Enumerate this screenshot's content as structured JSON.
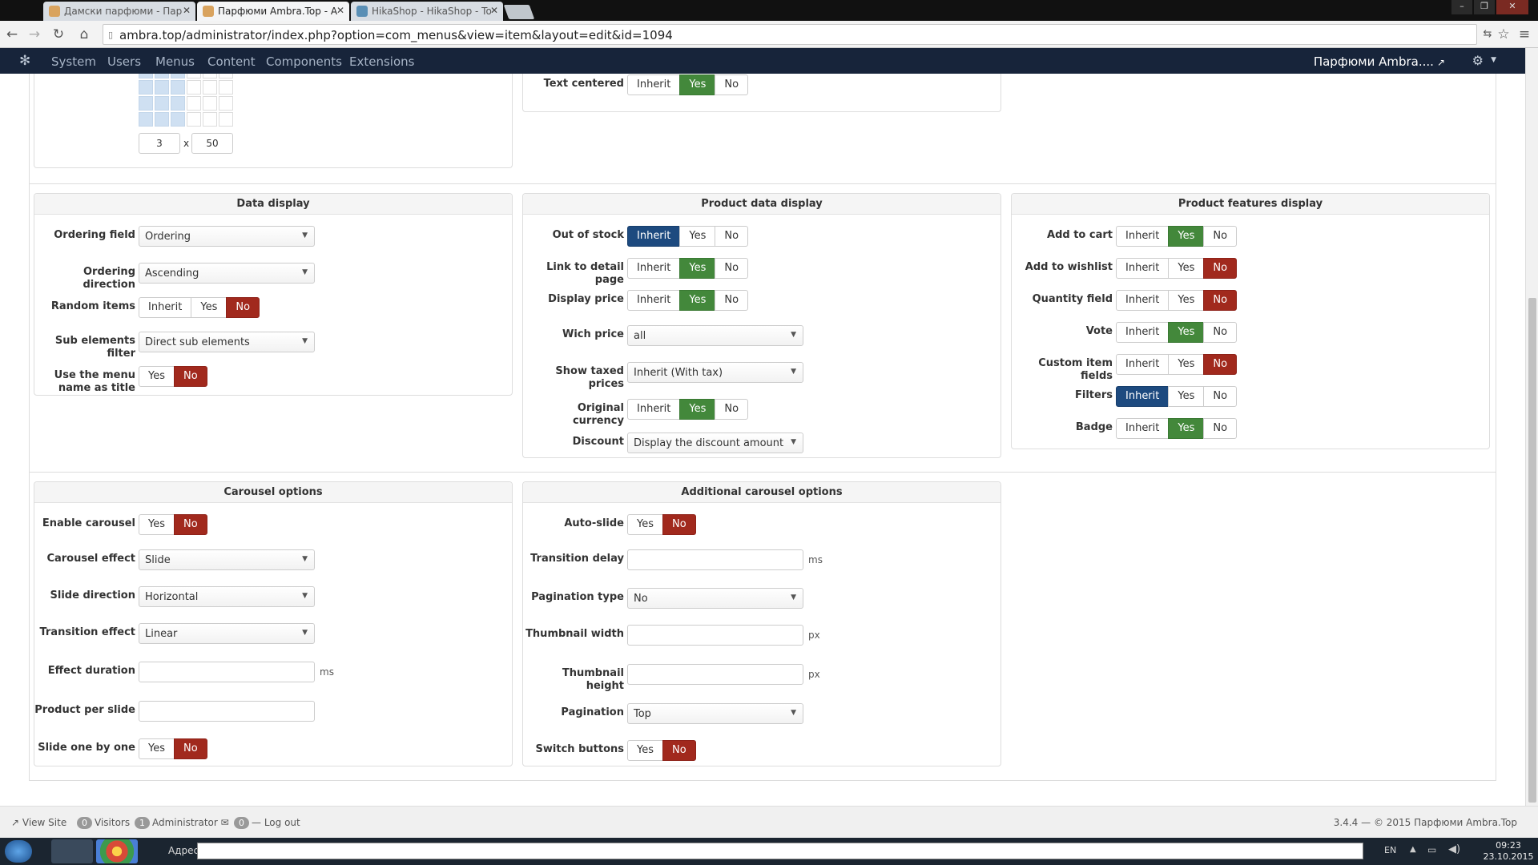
{
  "browser": {
    "tabs": [
      {
        "title": "Дамски парфюми - Пар"
      },
      {
        "title": "Парфюми Ambra.Top - А"
      },
      {
        "title": "HikaShop - HikaShop - To"
      }
    ],
    "url": "ambra.top/administrator/index.php?option=com_menus&view=item&layout=edit&id=1094"
  },
  "nav": {
    "menu": [
      "System",
      "Users",
      "Menus",
      "Content",
      "Components",
      "Extensions"
    ],
    "site_name": "Парфюми Ambra...."
  },
  "top_fragment": {
    "grid_cols": "3",
    "grid_x": "x",
    "grid_rows": "50",
    "text_centered": {
      "label": "Text centered",
      "options": [
        "Inherit",
        "Yes",
        "No"
      ],
      "selected": "Yes"
    }
  },
  "data_display": {
    "title": "Data display",
    "ordering_field": {
      "label": "Ordering field",
      "value": "Ordering"
    },
    "ordering_direction": {
      "label": "Ordering direction",
      "value": "Ascending"
    },
    "random_items": {
      "label": "Random items",
      "options": [
        "Inherit",
        "Yes",
        "No"
      ],
      "selected": "No"
    },
    "sub_elements_filter": {
      "label": "Sub elements filter",
      "value": "Direct sub elements"
    },
    "use_menu_name": {
      "label_line1": "Use the menu",
      "label_line2": "name as title",
      "options": [
        "Yes",
        "No"
      ],
      "selected": "No"
    }
  },
  "product_data_display": {
    "title": "Product data display",
    "out_of_stock": {
      "label": "Out of stock",
      "options": [
        "Inherit",
        "Yes",
        "No"
      ],
      "selected": "Inherit"
    },
    "link_to_detail": {
      "label": "Link to detail page",
      "options": [
        "Inherit",
        "Yes",
        "No"
      ],
      "selected": "Yes"
    },
    "display_price": {
      "label": "Display price",
      "options": [
        "Inherit",
        "Yes",
        "No"
      ],
      "selected": "Yes"
    },
    "wich_price": {
      "label": "Wich price",
      "value": "all"
    },
    "show_taxed_prices": {
      "label": "Show taxed prices",
      "value": "Inherit (With tax)"
    },
    "original_currency": {
      "label": "Original currency",
      "options": [
        "Inherit",
        "Yes",
        "No"
      ],
      "selected": "Yes"
    },
    "discount": {
      "label": "Discount",
      "value": "Display the discount amount"
    }
  },
  "product_features_display": {
    "title": "Product features display",
    "add_to_cart": {
      "label": "Add to cart",
      "options": [
        "Inherit",
        "Yes",
        "No"
      ],
      "selected": "Yes"
    },
    "add_to_wishlist": {
      "label": "Add to wishlist",
      "options": [
        "Inherit",
        "Yes",
        "No"
      ],
      "selected": "No"
    },
    "quantity_field": {
      "label": "Quantity field",
      "options": [
        "Inherit",
        "Yes",
        "No"
      ],
      "selected": "No"
    },
    "vote": {
      "label": "Vote",
      "options": [
        "Inherit",
        "Yes",
        "No"
      ],
      "selected": "Yes"
    },
    "custom_item_fields": {
      "label": "Custom item fields",
      "options": [
        "Inherit",
        "Yes",
        "No"
      ],
      "selected": "No"
    },
    "filters": {
      "label": "Filters",
      "options": [
        "Inherit",
        "Yes",
        "No"
      ],
      "selected": "Inherit"
    },
    "badge": {
      "label": "Badge",
      "options": [
        "Inherit",
        "Yes",
        "No"
      ],
      "selected": "Yes"
    }
  },
  "carousel_options": {
    "title": "Carousel options",
    "enable_carousel": {
      "label": "Enable carousel",
      "options": [
        "Yes",
        "No"
      ],
      "selected": "No"
    },
    "carousel_effect": {
      "label": "Carousel effect",
      "value": "Slide"
    },
    "slide_direction": {
      "label": "Slide direction",
      "value": "Horizontal"
    },
    "transition_effect": {
      "label": "Transition effect",
      "value": "Linear"
    },
    "effect_duration": {
      "label": "Effect duration",
      "value": "",
      "unit": "ms"
    },
    "product_per_slide": {
      "label": "Product per slide",
      "value": ""
    },
    "slide_one_by_one": {
      "label": "Slide one by one",
      "options": [
        "Yes",
        "No"
      ],
      "selected": "No"
    }
  },
  "additional_carousel_options": {
    "title": "Additional carousel options",
    "auto_slide": {
      "label": "Auto-slide",
      "options": [
        "Yes",
        "No"
      ],
      "selected": "No"
    },
    "transition_delay": {
      "label": "Transition delay",
      "value": "",
      "unit": "ms"
    },
    "pagination_type": {
      "label": "Pagination type",
      "value": "No"
    },
    "thumbnail_width": {
      "label": "Thumbnail width",
      "value": "",
      "unit": "px"
    },
    "thumbnail_height": {
      "label": "Thumbnail height",
      "value": "",
      "unit": "px"
    },
    "pagination": {
      "label": "Pagination",
      "value": "Top"
    },
    "switch_buttons": {
      "label": "Switch buttons",
      "options": [
        "Yes",
        "No"
      ],
      "selected": "No"
    }
  },
  "status": {
    "view_site": "View Site",
    "visitors_count": "0",
    "visitors": "Visitors",
    "admin_count": "1",
    "administrator": "Administrator",
    "messages_count": "0",
    "logout": "Log out",
    "version": "3.4.4 — © 2015 Парфюми Ambra.Top"
  },
  "taskbar": {
    "address_label": "Адрес",
    "lang": "EN",
    "time": "09:23",
    "date": "23.10.2015 г."
  },
  "colors": {
    "navbar": "#17243a",
    "yes": "#43883b",
    "no": "#a1291d",
    "inherit": "#1d4a7f"
  }
}
